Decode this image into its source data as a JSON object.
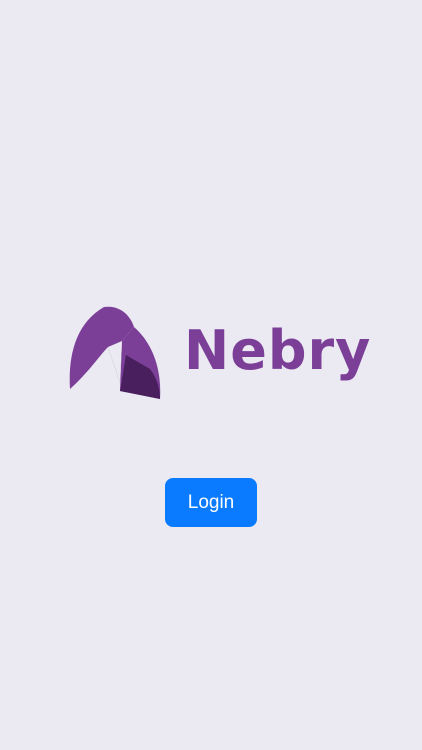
{
  "brand": {
    "name": "Nebry",
    "logo_icon": "nebry-arch-icon",
    "color_primary": "#7b3f98",
    "color_dark": "#4a1f5e"
  },
  "actions": {
    "login_label": "Login",
    "login_color": "#0a7bff"
  },
  "background_color": "#ebe9f1"
}
